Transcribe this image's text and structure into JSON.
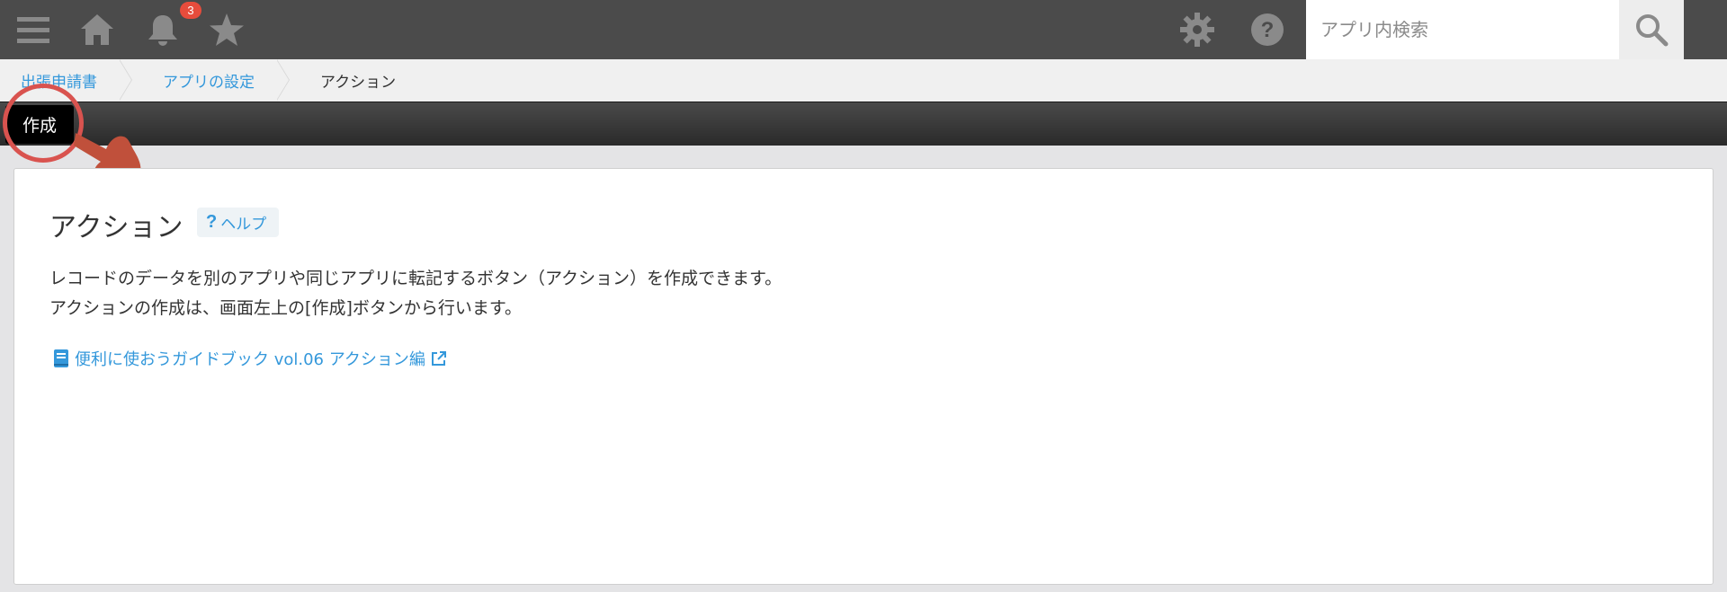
{
  "header": {
    "menu_icon": "hamburger-icon",
    "home_icon": "home-icon",
    "notification_icon": "bell-icon",
    "notification_count": "3",
    "favorite_icon": "star-icon",
    "settings_icon": "gear-icon",
    "help_icon": "question-circle-icon",
    "search_placeholder": "アプリ内検索",
    "search_icon": "search-icon",
    "bg_color": "#4b4b4b",
    "badge_color": "#e74c3c"
  },
  "breadcrumb": {
    "items": [
      {
        "label": "出張申請書"
      },
      {
        "label": "アプリの設定"
      },
      {
        "label": "アクション"
      }
    ],
    "link_color": "#3498db"
  },
  "toolbar": {
    "create_label": "作成"
  },
  "annotation": {
    "circle_color": "#d9534f",
    "hand_color": "#c0503b"
  },
  "main": {
    "title": "アクション",
    "help_label": "ヘルプ",
    "help_icon": "?",
    "description_line1": "レコードのデータを別のアプリや同じアプリに転記するボタン（アクション）を作成できます。",
    "description_line2": "アクションの作成は、画面左上の[作成]ボタンから行います。",
    "guide_link_label": "便利に使おうガイドブック vol.06 アクション編",
    "guide_icon": "book-icon",
    "external_icon": "external-link-icon"
  }
}
